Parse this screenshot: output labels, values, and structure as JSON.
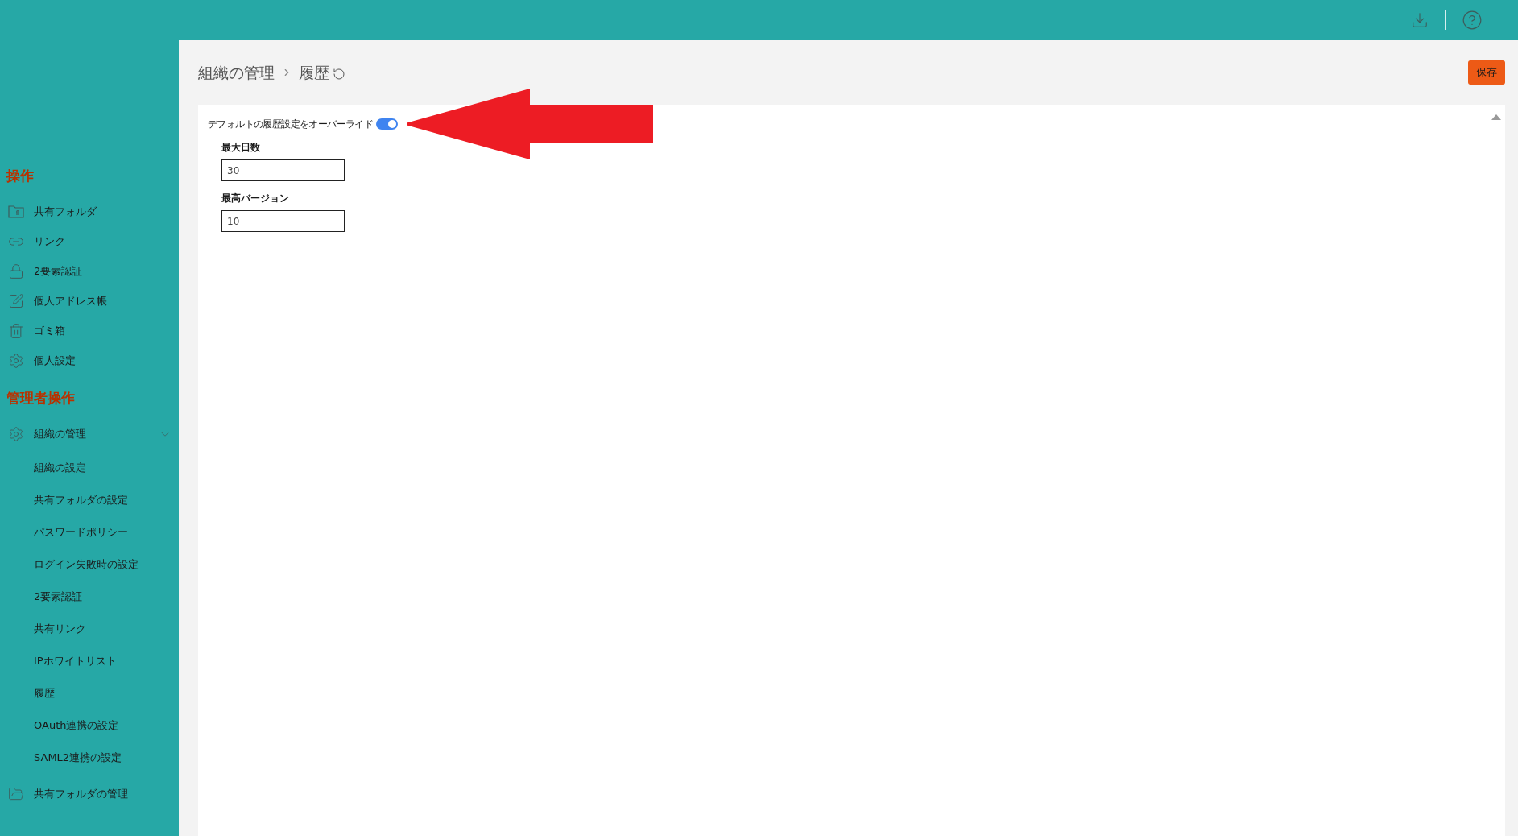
{
  "sidebar": {
    "sections": [
      {
        "heading": "操作",
        "items": [
          {
            "label": "共有フォルダ"
          },
          {
            "label": "リンク"
          },
          {
            "label": "2要素認証"
          },
          {
            "label": "個人アドレス帳"
          },
          {
            "label": "ゴミ箱"
          },
          {
            "label": "個人設定"
          }
        ]
      },
      {
        "heading": "管理者操作",
        "items": [
          {
            "label": "組織の管理",
            "expanded": true,
            "children": [
              {
                "label": "組織の設定"
              },
              {
                "label": "共有フォルダの設定"
              },
              {
                "label": "パスワードポリシー"
              },
              {
                "label": "ログイン失敗時の設定"
              },
              {
                "label": "2要素認証"
              },
              {
                "label": "共有リンク"
              },
              {
                "label": "IPホワイトリスト"
              },
              {
                "label": "履歴"
              },
              {
                "label": "OAuth連携の設定"
              },
              {
                "label": "SAML2連携の設定"
              }
            ]
          },
          {
            "label": "共有フォルダの管理"
          }
        ]
      }
    ]
  },
  "breadcrumb": [
    "組織の管理",
    "履歴"
  ],
  "save_button": "保存",
  "form": {
    "toggle": {
      "label": "デフォルトの履歴設定をオーバーライド",
      "on": true
    },
    "fields": [
      {
        "label": "最大日数",
        "value": "30"
      },
      {
        "label": "最高バージョン",
        "value": "10"
      }
    ]
  }
}
